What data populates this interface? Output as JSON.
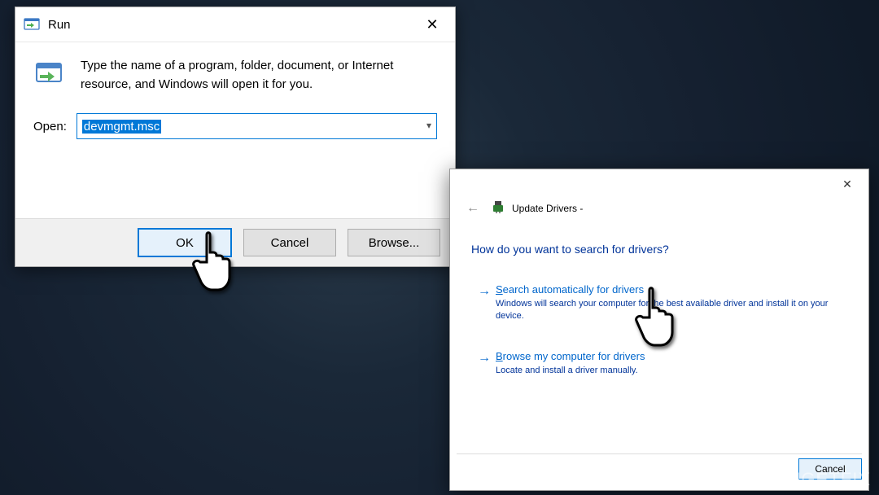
{
  "watermark": "UGETFIX",
  "run": {
    "title": "Run",
    "description": "Type the name of a program, folder, document, or Internet resource, and Windows will open it for you.",
    "open_label": "Open:",
    "input_value": "devmgmt.msc",
    "ok_label": "OK",
    "cancel_label": "Cancel",
    "browse_label": "Browse...",
    "close_symbol": "✕"
  },
  "update": {
    "back_symbol": "←",
    "title": "Update Drivers -",
    "close_symbol": "✕",
    "heading": "How do you want to search for drivers?",
    "opt1": {
      "title_pre": "S",
      "title_rest": "earch automatically for drivers",
      "desc": "Windows will search your computer for the best available driver and install it on your device."
    },
    "opt2": {
      "title_pre": "B",
      "title_rest": "rowse my computer for drivers",
      "desc": "Locate and install a driver manually."
    },
    "cancel_label": "Cancel"
  }
}
